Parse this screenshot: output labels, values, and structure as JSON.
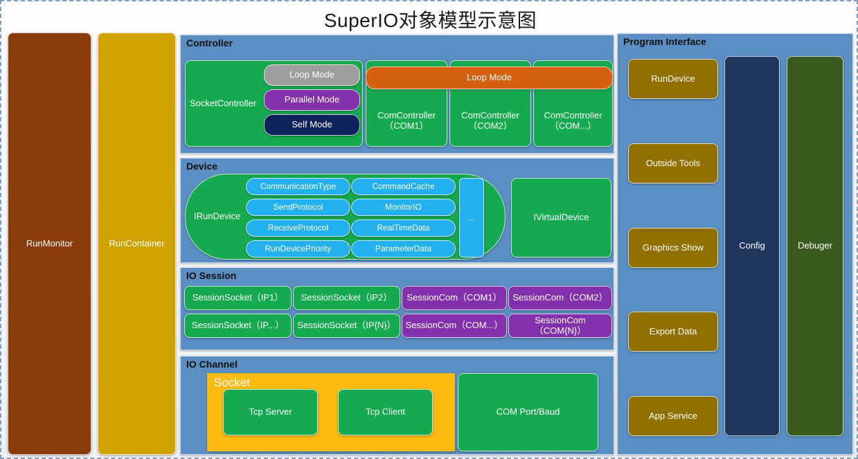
{
  "title": "SuperIO对象模型示意图",
  "left_columns": [
    {
      "label": "RunMonitor",
      "color": "#8a3c0c"
    },
    {
      "label": "RunContainer",
      "color": "#cfa200"
    }
  ],
  "center": {
    "panels": [
      {
        "title": "Controller",
        "socket_controller": {
          "label": "SocketController",
          "modes": [
            {
              "label": "Loop Mode",
              "color": "#9d9d9d"
            },
            {
              "label": "Parallel Mode",
              "color": "#8230ab"
            },
            {
              "label": "Self Mode",
              "color": "#0f2259"
            }
          ]
        },
        "loop_mode_bar": {
          "label": "Loop Mode",
          "color": "#d5600f"
        },
        "com_controllers": [
          {
            "line1": "ComController",
            "line2": "（COM1）"
          },
          {
            "line1": "ComController",
            "line2": "（COM2）"
          },
          {
            "line1": "ComController",
            "line2": "（COM...）"
          }
        ]
      },
      {
        "title": "Device",
        "irundevice": {
          "label": "IRunDevice",
          "col1": [
            "CommunicationType",
            "SendProtocol",
            "ReceiveProtocol",
            "RunDevicePriority"
          ],
          "col2": [
            "CommandCache",
            "MonitorIO",
            "RealTimeData",
            "ParameterData"
          ],
          "more": "..."
        },
        "ivirtualdevice": {
          "label": "IVirtualDevice"
        }
      },
      {
        "title": "IO Session",
        "sessions_row1": [
          {
            "label": "SessionSocket（IP1）",
            "color": "#16aa50"
          },
          {
            "label": "SessionSocket（IP2）",
            "color": "#16aa50"
          },
          {
            "label": "SessionCom（COM1）",
            "color": "#8230ab"
          },
          {
            "label": "SessionCom（COM2）",
            "color": "#8230ab"
          }
        ],
        "sessions_row2": [
          {
            "label": "SessionSocket（IP...）",
            "color": "#16aa50"
          },
          {
            "label": "SessionSocket（IP{N}）",
            "color": "#16aa50"
          },
          {
            "label": "SessionCom（COM...）",
            "color": "#8230ab"
          },
          {
            "label": "SessionCom\n（COM{N}）",
            "color": "#8230ab"
          }
        ]
      },
      {
        "title": "IO Channel",
        "socket": {
          "title": "Socket",
          "color": "#fdbb12",
          "children": [
            {
              "label": "Tcp Server"
            },
            {
              "label": "Tcp Client"
            }
          ]
        },
        "com_port": {
          "label": "COM Port/Baud"
        }
      }
    ]
  },
  "right": {
    "title": "Program Interface",
    "items": [
      {
        "label": "RunDevice",
        "color": "#8f7000"
      },
      {
        "label": "Outside Tools",
        "color": "#8f7000"
      },
      {
        "label": "Graphics Show",
        "color": "#8f7000"
      },
      {
        "label": "Export Data",
        "color": "#8f7000"
      },
      {
        "label": "App Service",
        "color": "#8f7000"
      }
    ],
    "tall_columns": [
      {
        "label": "Config",
        "color": "#20365f"
      },
      {
        "label": "Debuger",
        "color": "#3a5a1e"
      }
    ]
  }
}
